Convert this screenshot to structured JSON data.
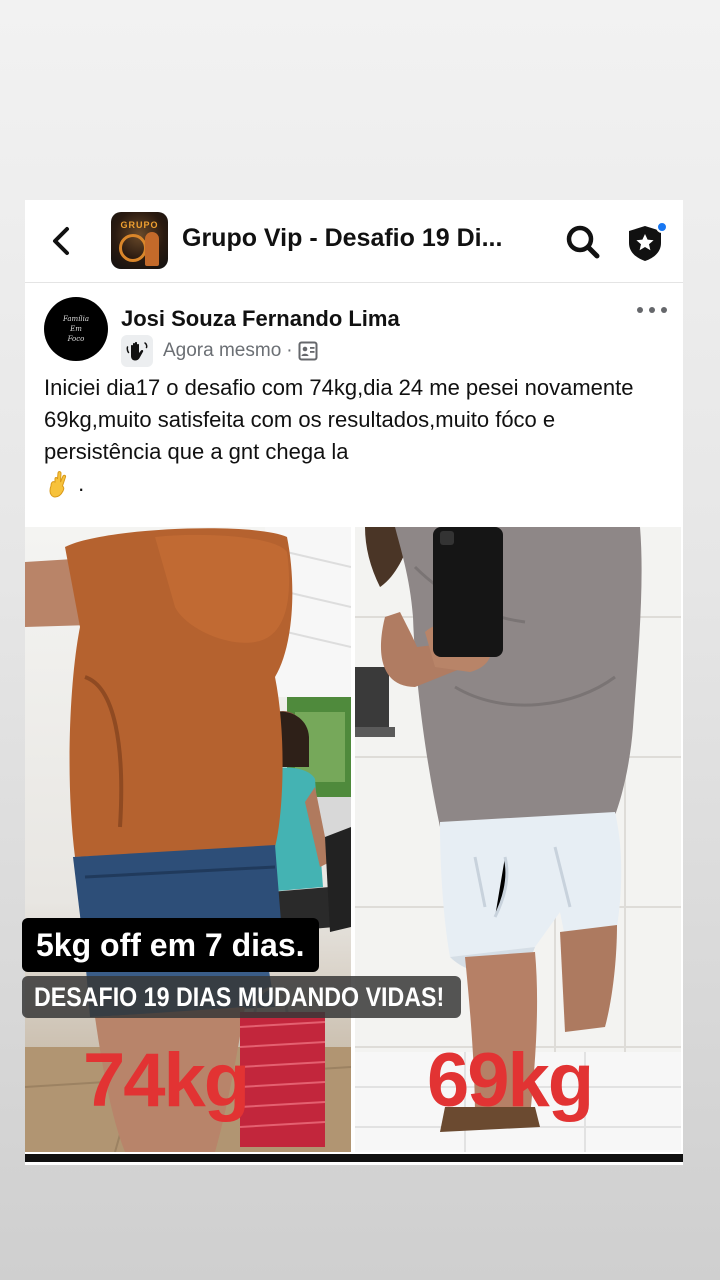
{
  "group": {
    "title": "Grupo Vip - Desafio 19 Di...",
    "avatar_text": "GRUPO"
  },
  "post": {
    "author": "Josi Souza Fernando Lima",
    "author_avatar_text": [
      "Família",
      "Em",
      "Foco"
    ],
    "time": "Agora mesmo",
    "separator": "·",
    "text": "Iniciei dia17 o desafio com 74kg,dia 24  me pesei novamente 69kg,muito satisfeita com os resultados,muito fóco  e persistência  que a gnt chega la",
    "text_end": "."
  },
  "photo": {
    "before_label": "74kg",
    "after_label": "69kg"
  },
  "captions": {
    "line1": "5kg off em 7 dias.",
    "line2": "DESAFIO 19 DIAS MUDANDO VIDAS!"
  },
  "icons": {
    "back": "chevron-left-icon",
    "search": "search-icon",
    "shield": "shield-star-icon",
    "more": "more-horizontal-icon",
    "badge": "waving-hand-icon",
    "audience": "group-audience-icon",
    "emoji": "crossed-fingers-icon"
  },
  "colors": {
    "notification_dot": "#1877f2",
    "weight_label": "#e23333",
    "caption_bg": "#000000"
  }
}
